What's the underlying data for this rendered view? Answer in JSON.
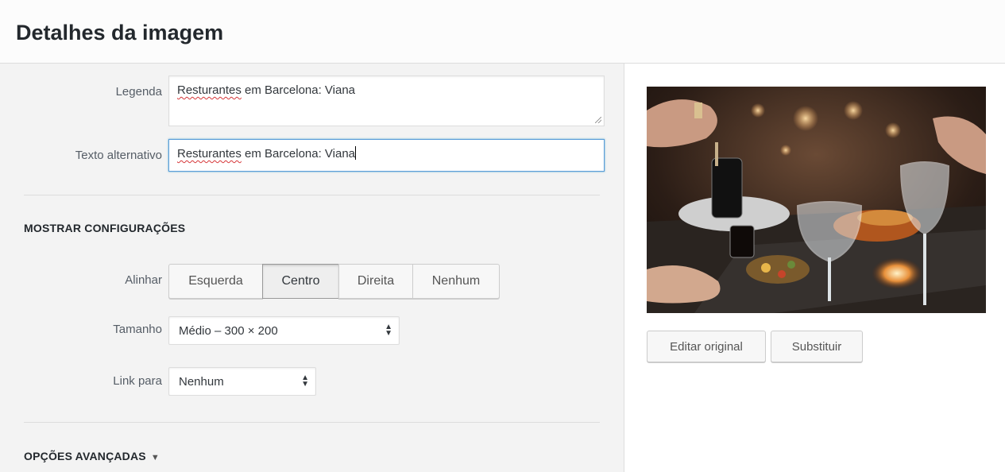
{
  "header": {
    "title": "Detalhes da imagem"
  },
  "fields": {
    "caption": {
      "label": "Legenda",
      "value_spell": "Resturantes",
      "value_rest": " em Barcelona: Viana"
    },
    "alt": {
      "label": "Texto alternativo",
      "value_spell": "Resturantes",
      "value_rest": " em Barcelona: Viana"
    }
  },
  "display": {
    "title": "MOSTRAR CONFIGURAÇÕES",
    "align": {
      "label": "Alinhar",
      "options": [
        "Esquerda",
        "Centro",
        "Direita",
        "Nenhum"
      ],
      "selected": "Centro"
    },
    "size": {
      "label": "Tamanho",
      "value": "Médio – 300 × 200"
    },
    "link": {
      "label": "Link para",
      "value": "Nenhum"
    }
  },
  "advanced": {
    "title": "OPÇÕES AVANÇADAS"
  },
  "image_actions": {
    "edit_label": "Editar original",
    "replace_label": "Substituir"
  },
  "colors": {
    "focus": "#5b9dd9",
    "panel_bg": "#f3f3f3",
    "spell": "#d63638"
  }
}
